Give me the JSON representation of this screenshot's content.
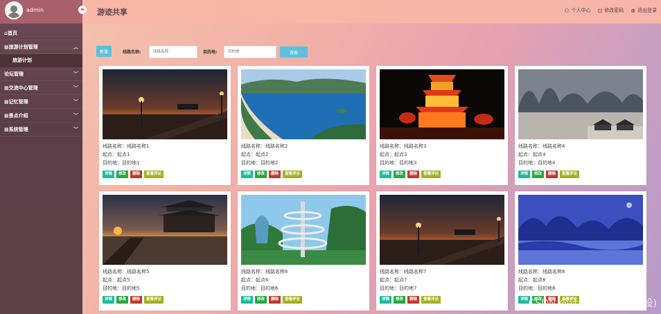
{
  "sidebar": {
    "user": "admin",
    "menu": [
      {
        "label": "首页",
        "has_children": false
      },
      {
        "label": "旅游计划管理",
        "has_children": true,
        "expanded": true,
        "children": [
          "旅游计划"
        ]
      },
      {
        "label": "论坛管理",
        "has_children": true
      },
      {
        "label": "交流中心管理",
        "has_children": true
      },
      {
        "label": "记忆管理",
        "has_children": true
      },
      {
        "label": "景点介绍",
        "has_children": true
      },
      {
        "label": "系统管理",
        "has_children": true
      }
    ]
  },
  "header": {
    "title": "游迹共享",
    "links": [
      {
        "label": "个人中心",
        "icon": "user-icon"
      },
      {
        "label": "修改密码",
        "icon": "lock-icon"
      },
      {
        "label": "退出登录",
        "icon": "logout-icon"
      }
    ]
  },
  "toolbar": {
    "add_label": "新增",
    "route_label": "线路名称:",
    "route_placeholder": "线路名称",
    "dest_label": "目的地:",
    "dest_placeholder": "目的地",
    "search_label": "搜索"
  },
  "cards": [
    {
      "route": "线路名称：线路名称1",
      "start": "起点：起点1",
      "dest": "目的地：目的地1",
      "image": "pier-sunset"
    },
    {
      "route": "线路名称：线路名称2",
      "start": "起点：起点2",
      "dest": "目的地：目的地2",
      "image": "coastal-bay"
    },
    {
      "route": "线路名称：线路名称3",
      "start": "起点：起点3",
      "dest": "目的地：目的地3",
      "image": "night-pagoda"
    },
    {
      "route": "线路名称：线路名称4",
      "start": "起点：起点4",
      "dest": "目的地：目的地4",
      "image": "karst-river"
    },
    {
      "route": "线路名称：线路名称5",
      "start": "起点：起点5",
      "dest": "目的地：目的地5",
      "image": "pavilion-sunset"
    },
    {
      "route": "线路名称：线路名称6",
      "start": "起点：起点6",
      "dest": "目的地：目的地6",
      "image": "spiral-tower"
    },
    {
      "route": "线路名称：线路名称7",
      "start": "起点：起点7",
      "dest": "目的地：目的地7",
      "image": "pier-sunset"
    },
    {
      "route": "线路名称：线路名称8",
      "start": "起点：起点8",
      "dest": "目的地：目的地8",
      "image": "blue-mountains"
    }
  ],
  "actions": {
    "detail": "详情",
    "edit": "修改",
    "delete": "删除",
    "review": "查看评论"
  },
  "watermark": "CSDN @计算机Dian(接毕设)",
  "colors": {
    "primary_button": "#5bc0de",
    "detail": "#1abc9c",
    "edit": "#27a844",
    "delete": "#c0392b",
    "review": "#a5b021"
  }
}
